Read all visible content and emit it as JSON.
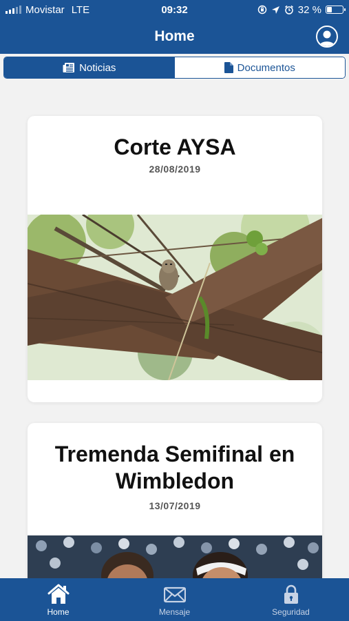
{
  "status_bar": {
    "carrier": "Movistar",
    "network": "LTE",
    "time": "09:32",
    "battery": "32 %",
    "battery_level": 0.32
  },
  "header": {
    "title": "Home",
    "profile_icon": "user-circle-icon"
  },
  "segments": [
    {
      "label": "Noticias",
      "icon": "newspaper-icon",
      "selected": true
    },
    {
      "label": "Documentos",
      "icon": "document-icon",
      "selected": false
    }
  ],
  "news": [
    {
      "title": "Corte AYSA",
      "date": "28/08/2019",
      "image": "owl-on-wooden-beams-photo"
    },
    {
      "title": "Tremenda Semifinal en Wimbledon",
      "date": "13/07/2019",
      "image": "tennis-players-photo"
    }
  ],
  "tab_bar": [
    {
      "label": "Home",
      "icon": "home-icon",
      "selected": true
    },
    {
      "label": "Mensaje",
      "icon": "envelope-icon",
      "selected": false
    },
    {
      "label": "Seguridad",
      "icon": "lock-icon",
      "selected": false
    }
  ],
  "colors": {
    "primary": "#1b5496",
    "background": "#f2f2f2",
    "card": "#ffffff"
  }
}
